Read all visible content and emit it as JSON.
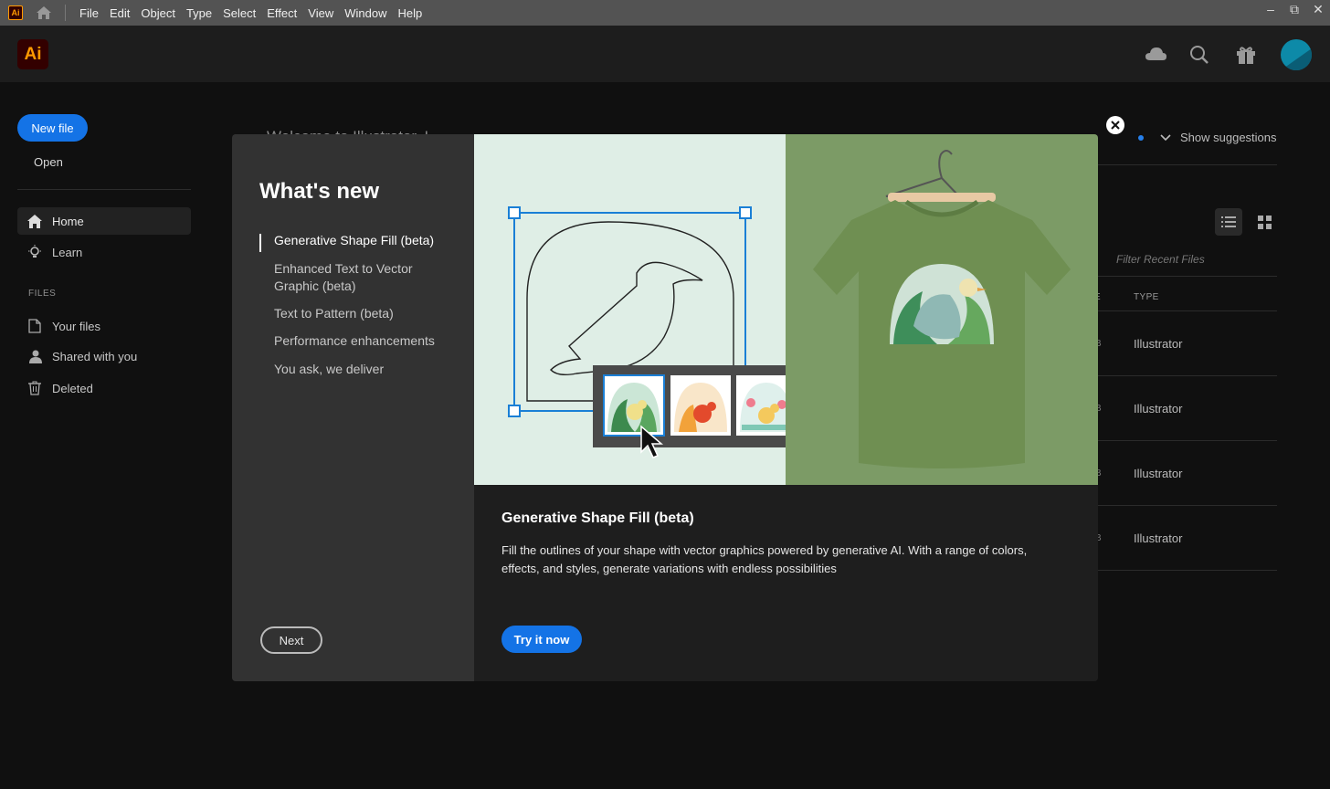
{
  "menubar": {
    "app_icon": "Ai",
    "items": [
      "File",
      "Edit",
      "Object",
      "Type",
      "Select",
      "Effect",
      "View",
      "Window",
      "Help"
    ]
  },
  "header": {
    "logo": "Ai",
    "icons": [
      "cloud-icon",
      "search-icon",
      "gift-icon",
      "avatar"
    ]
  },
  "sidebar": {
    "new_file": "New file",
    "open": "Open",
    "nav": [
      {
        "label": "Home",
        "icon": "home-icon",
        "active": true
      },
      {
        "label": "Learn",
        "icon": "lightbulb-icon",
        "active": false
      }
    ],
    "files_header": "FILES",
    "files": [
      {
        "label": "Your files",
        "icon": "file-icon"
      },
      {
        "label": "Shared with you",
        "icon": "people-icon"
      },
      {
        "label": "Deleted",
        "icon": "trash-icon"
      }
    ]
  },
  "main": {
    "welcome": "Welcome to Illustrator, L",
    "show_suggestions": "Show suggestions",
    "filter_placeholder": "Filter Recent Files",
    "col_type": "TYPE",
    "col_e": "E",
    "rows": [
      {
        "size": "B",
        "type": "Illustrator"
      },
      {
        "size": "B",
        "type": "Illustrator"
      },
      {
        "size": "B",
        "type": "Illustrator"
      },
      {
        "size": "B",
        "type": "Illustrator"
      }
    ]
  },
  "dialog": {
    "title": "What's new",
    "features": [
      {
        "label": "Generative Shape Fill (beta)",
        "active": true
      },
      {
        "label": "Enhanced Text to Vector Graphic (beta)",
        "active": false
      },
      {
        "label": "Text to Pattern (beta)",
        "active": false
      },
      {
        "label": "Performance enhancements",
        "active": false
      },
      {
        "label": "You ask, we deliver",
        "active": false
      }
    ],
    "next": "Next",
    "highlight_title": "Generative Shape Fill (beta)",
    "highlight_desc": "Fill the outlines of your shape with vector graphics powered by generative AI. With a range of colors, effects, and styles, generate variations with endless possibilities",
    "try_now": "Try it now"
  },
  "colors": {
    "accent": "#1473e6",
    "brand_orange": "#ff9a00",
    "hero_bg": "#dfeee6",
    "shirt_bg": "#7c9b66"
  }
}
